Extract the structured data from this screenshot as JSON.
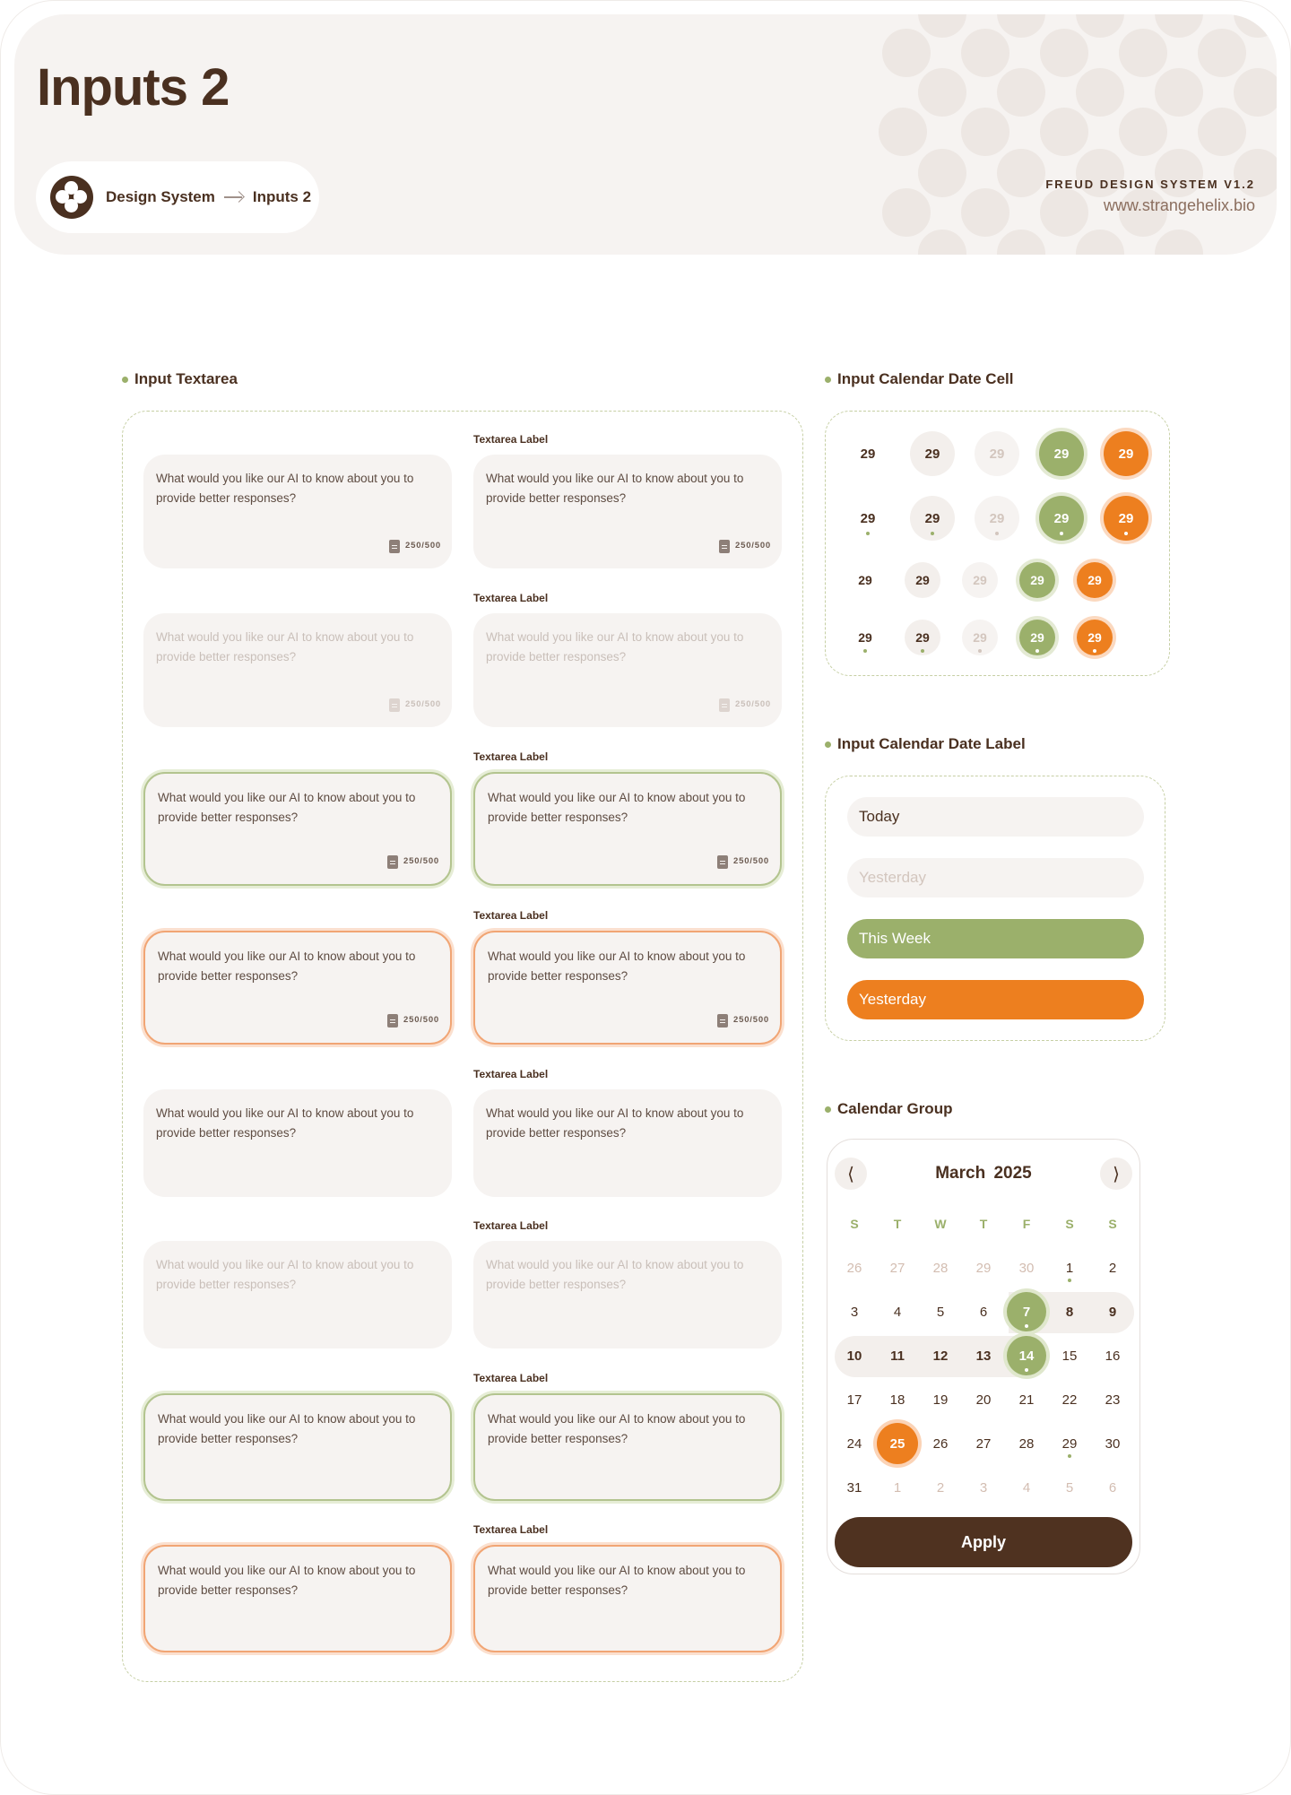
{
  "header": {
    "title": "Inputs 2",
    "breadcrumb": [
      "Design System",
      "Inputs 2"
    ],
    "brand_name": "FREUD DESIGN SYSTEM V1.2",
    "brand_url": "www.strangehelix.bio"
  },
  "sections": {
    "textarea": "Input Textarea",
    "date_cell": "Input Calendar Date Cell",
    "date_label": "Input Calendar Date Label",
    "calendar_group": "Calendar Group"
  },
  "textarea": {
    "label": "Textarea Label",
    "placeholder": "What would you like our AI to know about you to provide better responses?",
    "counter": "250/500"
  },
  "date_cell": {
    "value": "29"
  },
  "date_labels": [
    "Today",
    "Yesterday",
    "This Week",
    "Yesterday"
  ],
  "calendar": {
    "month": "March",
    "year": "2025",
    "prev_icon": "chevron-left-icon",
    "next_icon": "chevron-right-icon",
    "weekdays": [
      "S",
      "T",
      "W",
      "T",
      "F",
      "S",
      "S"
    ],
    "weeks": [
      [
        "26",
        "27",
        "28",
        "29",
        "30",
        "1",
        "2"
      ],
      [
        "3",
        "4",
        "5",
        "6",
        "7",
        "8",
        "9"
      ],
      [
        "10",
        "11",
        "12",
        "13",
        "14",
        "15",
        "16"
      ],
      [
        "17",
        "18",
        "19",
        "20",
        "21",
        "22",
        "23"
      ],
      [
        "24",
        "25",
        "26",
        "27",
        "28",
        "29",
        "30"
      ],
      [
        "31",
        "1",
        "2",
        "3",
        "4",
        "5",
        "6"
      ]
    ],
    "apply_label": "Apply"
  },
  "colors": {
    "brown": "#4a3020",
    "green": "#9bb06b",
    "orange": "#ed7f1f",
    "surface": "#f6f3f1"
  }
}
